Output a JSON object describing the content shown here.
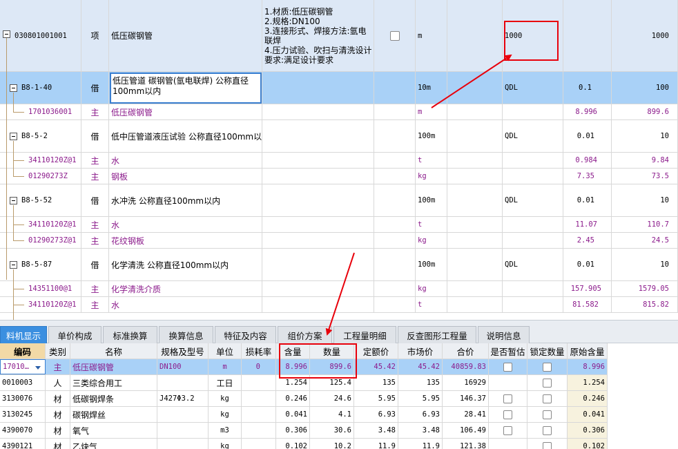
{
  "upper_rows": [
    {
      "code": "030801001001",
      "type": "项",
      "name": "低压碳钢管",
      "features": "1.材质:低压碳钢管\n2.规格:DN100\n3.连接形式、焊接方法:氩电联焊\n4.压力试验、吹扫与清洗设计要求:满足设计要求",
      "unit": "m",
      "expr": "1000",
      "qty": "1000"
    },
    {
      "code": "B8-1-40",
      "type": "借",
      "name": "低压管道 碳钢管(氩电联焊) 公称直径100mm以内",
      "unit": "10m",
      "expr": "QDL",
      "coef": "0.1",
      "qty": "100"
    },
    {
      "code": "1701036001",
      "type": "主",
      "name": "低压碳钢管",
      "unit": "m",
      "coef": "8.996",
      "qty": "899.6"
    },
    {
      "code": "B8-5-2",
      "type": "借",
      "name": "低中压管道液压试验 公称直径100mm以内",
      "unit": "100m",
      "expr": "QDL",
      "coef": "0.01",
      "qty": "10"
    },
    {
      "code": "34110120Z@1",
      "type": "主",
      "name": "水",
      "unit": "t",
      "coef": "0.984",
      "qty": "9.84"
    },
    {
      "code": "01290273Z",
      "type": "主",
      "name": "钢板",
      "unit": "kg",
      "coef": "7.35",
      "qty": "73.5"
    },
    {
      "code": "B8-5-52",
      "type": "借",
      "name": "水冲洗 公称直径100mm以内",
      "unit": "100m",
      "expr": "QDL",
      "coef": "0.01",
      "qty": "10"
    },
    {
      "code": "34110120Z@1",
      "type": "主",
      "name": "水",
      "unit": "t",
      "coef": "11.07",
      "qty": "110.7"
    },
    {
      "code": "01290273Z@1",
      "type": "主",
      "name": "花纹钢板",
      "unit": "kg",
      "coef": "2.45",
      "qty": "24.5"
    },
    {
      "code": "B8-5-87",
      "type": "借",
      "name": "化学清洗 公称直径100mm以内",
      "unit": "100m",
      "expr": "QDL",
      "coef": "0.01",
      "qty": "10"
    },
    {
      "code": "14351100@1",
      "type": "主",
      "name": "化学清洗介质",
      "unit": "kg",
      "coef": "157.905",
      "qty": "1579.05"
    },
    {
      "code": "34110120Z@1",
      "type": "主",
      "name": "水",
      "unit": "t",
      "coef": "81.582",
      "qty": "815.82"
    }
  ],
  "tabs": [
    "料机显示",
    "单价构成",
    "标准换算",
    "换算信息",
    "特征及内容",
    "组价方案",
    "工程量明细",
    "反查图形工程量",
    "说明信息"
  ],
  "lower_headers": [
    "编码",
    "类别",
    "名称",
    "规格及型号",
    "单位",
    "损耗率",
    "含量",
    "数量",
    "定额价",
    "市场价",
    "合价",
    "是否暂估",
    "锁定数量",
    "原始含量"
  ],
  "lower_rows": [
    {
      "code": "17010…",
      "type": "主",
      "name": "低压碳钢管",
      "spec": "DN100",
      "unit": "m",
      "loss": "0",
      "content": "8.996",
      "qty": "899.6",
      "quota_price": "45.42",
      "market_price": "45.42",
      "total": "40859.83",
      "orig": "8.996"
    },
    {
      "code": "0010003",
      "type": "人",
      "name": "三类综合用工",
      "spec": "",
      "unit": "工日",
      "loss": "",
      "content": "1.254",
      "qty": "125.4",
      "quota_price": "135",
      "market_price": "135",
      "total": "16929",
      "orig": "1.254"
    },
    {
      "code": "3130076",
      "type": "材",
      "name": "低碳钢焊条",
      "spec": "J427Φ3.2",
      "unit": "kg",
      "loss": "",
      "content": "0.246",
      "qty": "24.6",
      "quota_price": "5.95",
      "market_price": "5.95",
      "total": "146.37",
      "orig": "0.246"
    },
    {
      "code": "3130245",
      "type": "材",
      "name": "碳钢焊丝",
      "spec": "",
      "unit": "kg",
      "loss": "",
      "content": "0.041",
      "qty": "4.1",
      "quota_price": "6.93",
      "market_price": "6.93",
      "total": "28.41",
      "orig": "0.041"
    },
    {
      "code": "4390070",
      "type": "材",
      "name": "氧气",
      "spec": "",
      "unit": "m3",
      "loss": "",
      "content": "0.306",
      "qty": "30.6",
      "quota_price": "3.48",
      "market_price": "3.48",
      "total": "106.49",
      "orig": "0.306"
    },
    {
      "code": "4390121",
      "type": "材",
      "name": "乙炔气",
      "spec": "",
      "unit": "kg",
      "loss": "",
      "content": "0.102",
      "qty": "10.2",
      "quota_price": "11.9",
      "market_price": "11.9",
      "total": "121.38",
      "orig": "0.102"
    }
  ],
  "colors": {
    "selected_row": "#a9d1f7",
    "active_tab": "#3b8fe0",
    "annotation": "#e8000b",
    "material_text": "#8b1a8b"
  }
}
